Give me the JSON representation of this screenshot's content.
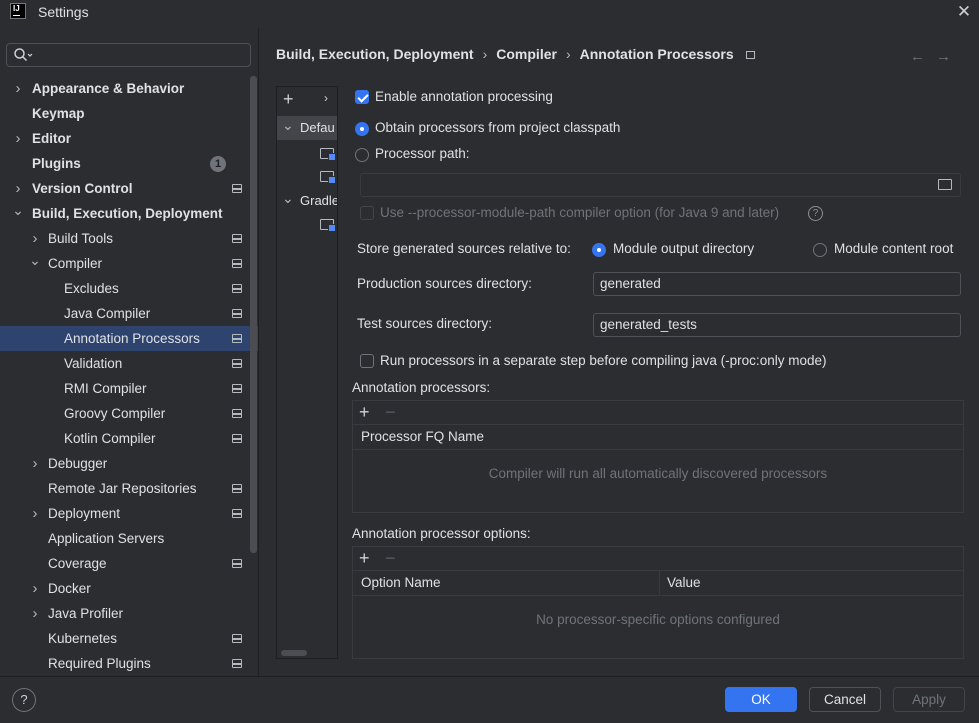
{
  "window": {
    "title": "Settings",
    "logo_text": "IJ"
  },
  "search": {
    "placeholder": ""
  },
  "sidebar": {
    "items": [
      {
        "label": "Appearance & Behavior",
        "bold": true,
        "chevron": "right",
        "indent": 0,
        "proj": false
      },
      {
        "label": "Keymap",
        "bold": true,
        "chevron": "",
        "indent": 0,
        "proj": false
      },
      {
        "label": "Editor",
        "bold": true,
        "chevron": "right",
        "indent": 0,
        "proj": false
      },
      {
        "label": "Plugins",
        "bold": true,
        "chevron": "",
        "indent": 0,
        "proj": false,
        "badge": "1"
      },
      {
        "label": "Version Control",
        "bold": true,
        "chevron": "right",
        "indent": 0,
        "proj": true
      },
      {
        "label": "Build, Execution, Deployment",
        "bold": true,
        "chevron": "down",
        "indent": 0,
        "proj": false
      },
      {
        "label": "Build Tools",
        "bold": false,
        "chevron": "right",
        "indent": 1,
        "proj": true
      },
      {
        "label": "Compiler",
        "bold": false,
        "chevron": "down",
        "indent": 1,
        "proj": true
      },
      {
        "label": "Excludes",
        "bold": false,
        "chevron": "",
        "indent": 2,
        "proj": true
      },
      {
        "label": "Java Compiler",
        "bold": false,
        "chevron": "",
        "indent": 2,
        "proj": true
      },
      {
        "label": "Annotation Processors",
        "bold": false,
        "chevron": "",
        "indent": 2,
        "proj": true,
        "selected": true
      },
      {
        "label": "Validation",
        "bold": false,
        "chevron": "",
        "indent": 2,
        "proj": true
      },
      {
        "label": "RMI Compiler",
        "bold": false,
        "chevron": "",
        "indent": 2,
        "proj": true
      },
      {
        "label": "Groovy Compiler",
        "bold": false,
        "chevron": "",
        "indent": 2,
        "proj": true
      },
      {
        "label": "Kotlin Compiler",
        "bold": false,
        "chevron": "",
        "indent": 2,
        "proj": true
      },
      {
        "label": "Debugger",
        "bold": false,
        "chevron": "right",
        "indent": 1,
        "proj": false
      },
      {
        "label": "Remote Jar Repositories",
        "bold": false,
        "chevron": "",
        "indent": 1,
        "proj": true
      },
      {
        "label": "Deployment",
        "bold": false,
        "chevron": "right",
        "indent": 1,
        "proj": true
      },
      {
        "label": "Application Servers",
        "bold": false,
        "chevron": "",
        "indent": 1,
        "proj": false
      },
      {
        "label": "Coverage",
        "bold": false,
        "chevron": "",
        "indent": 1,
        "proj": true
      },
      {
        "label": "Docker",
        "bold": false,
        "chevron": "right",
        "indent": 1,
        "proj": false
      },
      {
        "label": "Java Profiler",
        "bold": false,
        "chevron": "right",
        "indent": 1,
        "proj": false
      },
      {
        "label": "Kubernetes",
        "bold": false,
        "chevron": "",
        "indent": 1,
        "proj": true
      },
      {
        "label": "Required Plugins",
        "bold": false,
        "chevron": "",
        "indent": 1,
        "proj": true
      }
    ]
  },
  "breadcrumb": {
    "part1": "Build, Execution, Deployment",
    "sep": "›",
    "part2": "Compiler",
    "part3": "Annotation Processors"
  },
  "nav": {
    "back": "←",
    "forward": "→"
  },
  "profiles": {
    "add": "+",
    "more": "›",
    "rows": [
      {
        "label": "Defau",
        "kind": "group",
        "selected": true
      },
      {
        "label": "",
        "kind": "module"
      },
      {
        "label": "",
        "kind": "module"
      },
      {
        "label": "Gradle",
        "kind": "group"
      },
      {
        "label": "",
        "kind": "module"
      }
    ]
  },
  "form": {
    "enable_processing": {
      "label": "Enable annotation processing",
      "checked": true
    },
    "from_classpath": {
      "label": "Obtain processors from project classpath",
      "selected": true
    },
    "processor_path": {
      "label": "Processor path:",
      "selected": false,
      "value": ""
    },
    "module_path_option": {
      "label": "Use --processor-module-path compiler option (for Java 9 and later)",
      "checked": false,
      "enabled": false
    },
    "store_label": "Store generated sources relative to:",
    "store_module_output": {
      "label": "Module output directory",
      "selected": true
    },
    "store_content_root": {
      "label": "Module content root",
      "selected": false
    },
    "production_dir": {
      "label": "Production sources directory:",
      "value": "generated"
    },
    "test_dir": {
      "label": "Test sources directory:",
      "value": "generated_tests"
    },
    "separate_step": {
      "label": "Run processors in a separate step before compiling java (-proc:only mode)",
      "checked": false
    }
  },
  "processors_table": {
    "title": "Annotation processors:",
    "add": "+",
    "remove": "−",
    "header": "Processor FQ Name",
    "empty_text": "Compiler will run all automatically discovered processors"
  },
  "options_table": {
    "title": "Annotation processor options:",
    "add": "+",
    "remove": "−",
    "col_name": "Option Name",
    "col_value": "Value",
    "empty_text": "No processor-specific options configured"
  },
  "buttons": {
    "help": "?",
    "ok": "OK",
    "cancel": "Cancel",
    "apply": "Apply"
  },
  "colors": {
    "accent": "#3574f0",
    "background": "#2b2d30",
    "selection": "#2e436e"
  }
}
